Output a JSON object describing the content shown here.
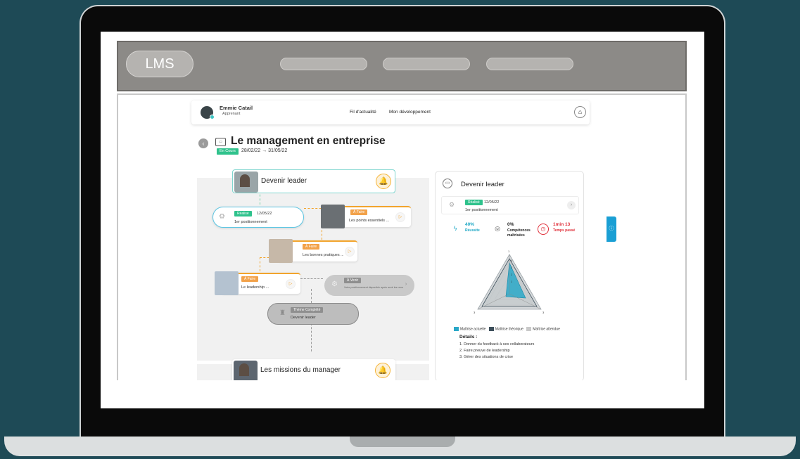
{
  "lms": {
    "logo": "LMS"
  },
  "header": {
    "user_name": "Emmie Catail",
    "user_role": "Apprenant",
    "nav": [
      "Fil d'actualité",
      "Mon développement"
    ]
  },
  "course": {
    "title": "Le management en entreprise",
    "status": "En Cours",
    "dates": "28/02/22 → 31/05/22"
  },
  "modules": [
    {
      "title": "Devenir leader"
    },
    {
      "title": "Les missions du manager"
    }
  ],
  "steps": [
    {
      "badge": "Réalisé",
      "date": "12/05/22",
      "label": "1er positionnement"
    },
    {
      "badge": "À Faire",
      "label": "Les points essentiels ..."
    },
    {
      "badge": "À Faire",
      "label": "Les bonnes pratiques ..."
    },
    {
      "badge": "À Faire",
      "label": "Le leadership ..."
    },
    {
      "badge": "À Venir",
      "label": "Votre positionnement disponible après avoir les recommandations"
    },
    {
      "badge": "Thème Complété",
      "label": "Devenir leader"
    }
  ],
  "panel": {
    "title": "Devenir leader",
    "step_badge": "Réalisé",
    "step_date": "12/05/22",
    "step_label": "1er positionnement",
    "stats": [
      {
        "value": "40%",
        "label": "Réussite",
        "color": "#1aa6c4"
      },
      {
        "value": "0%",
        "label": "Compétences maîtrisées",
        "color": "#222222"
      },
      {
        "value": "1min 13",
        "label": "Temps passé",
        "color": "#e0303a"
      }
    ],
    "radar_labels": [
      "1",
      "4",
      "3",
      "2",
      "1",
      "3",
      "3"
    ],
    "legend": [
      "Maîtrise actuelle",
      "Maîtrise théorique",
      "Maîtrise attendue"
    ],
    "legend_colors": [
      "#2aa8c8",
      "#3c4e5a",
      "#c9c9c9"
    ],
    "details_title": "Détails :",
    "details": [
      "1. Donner du feedback à ses collaborateurs",
      "2. Faire preuve de leadership",
      "3. Gérer des situations de crise"
    ]
  },
  "colors": {
    "background": "#1e4a56",
    "accent": "#f2a42c",
    "success": "#2fc28c",
    "info": "#1a9fd4"
  }
}
